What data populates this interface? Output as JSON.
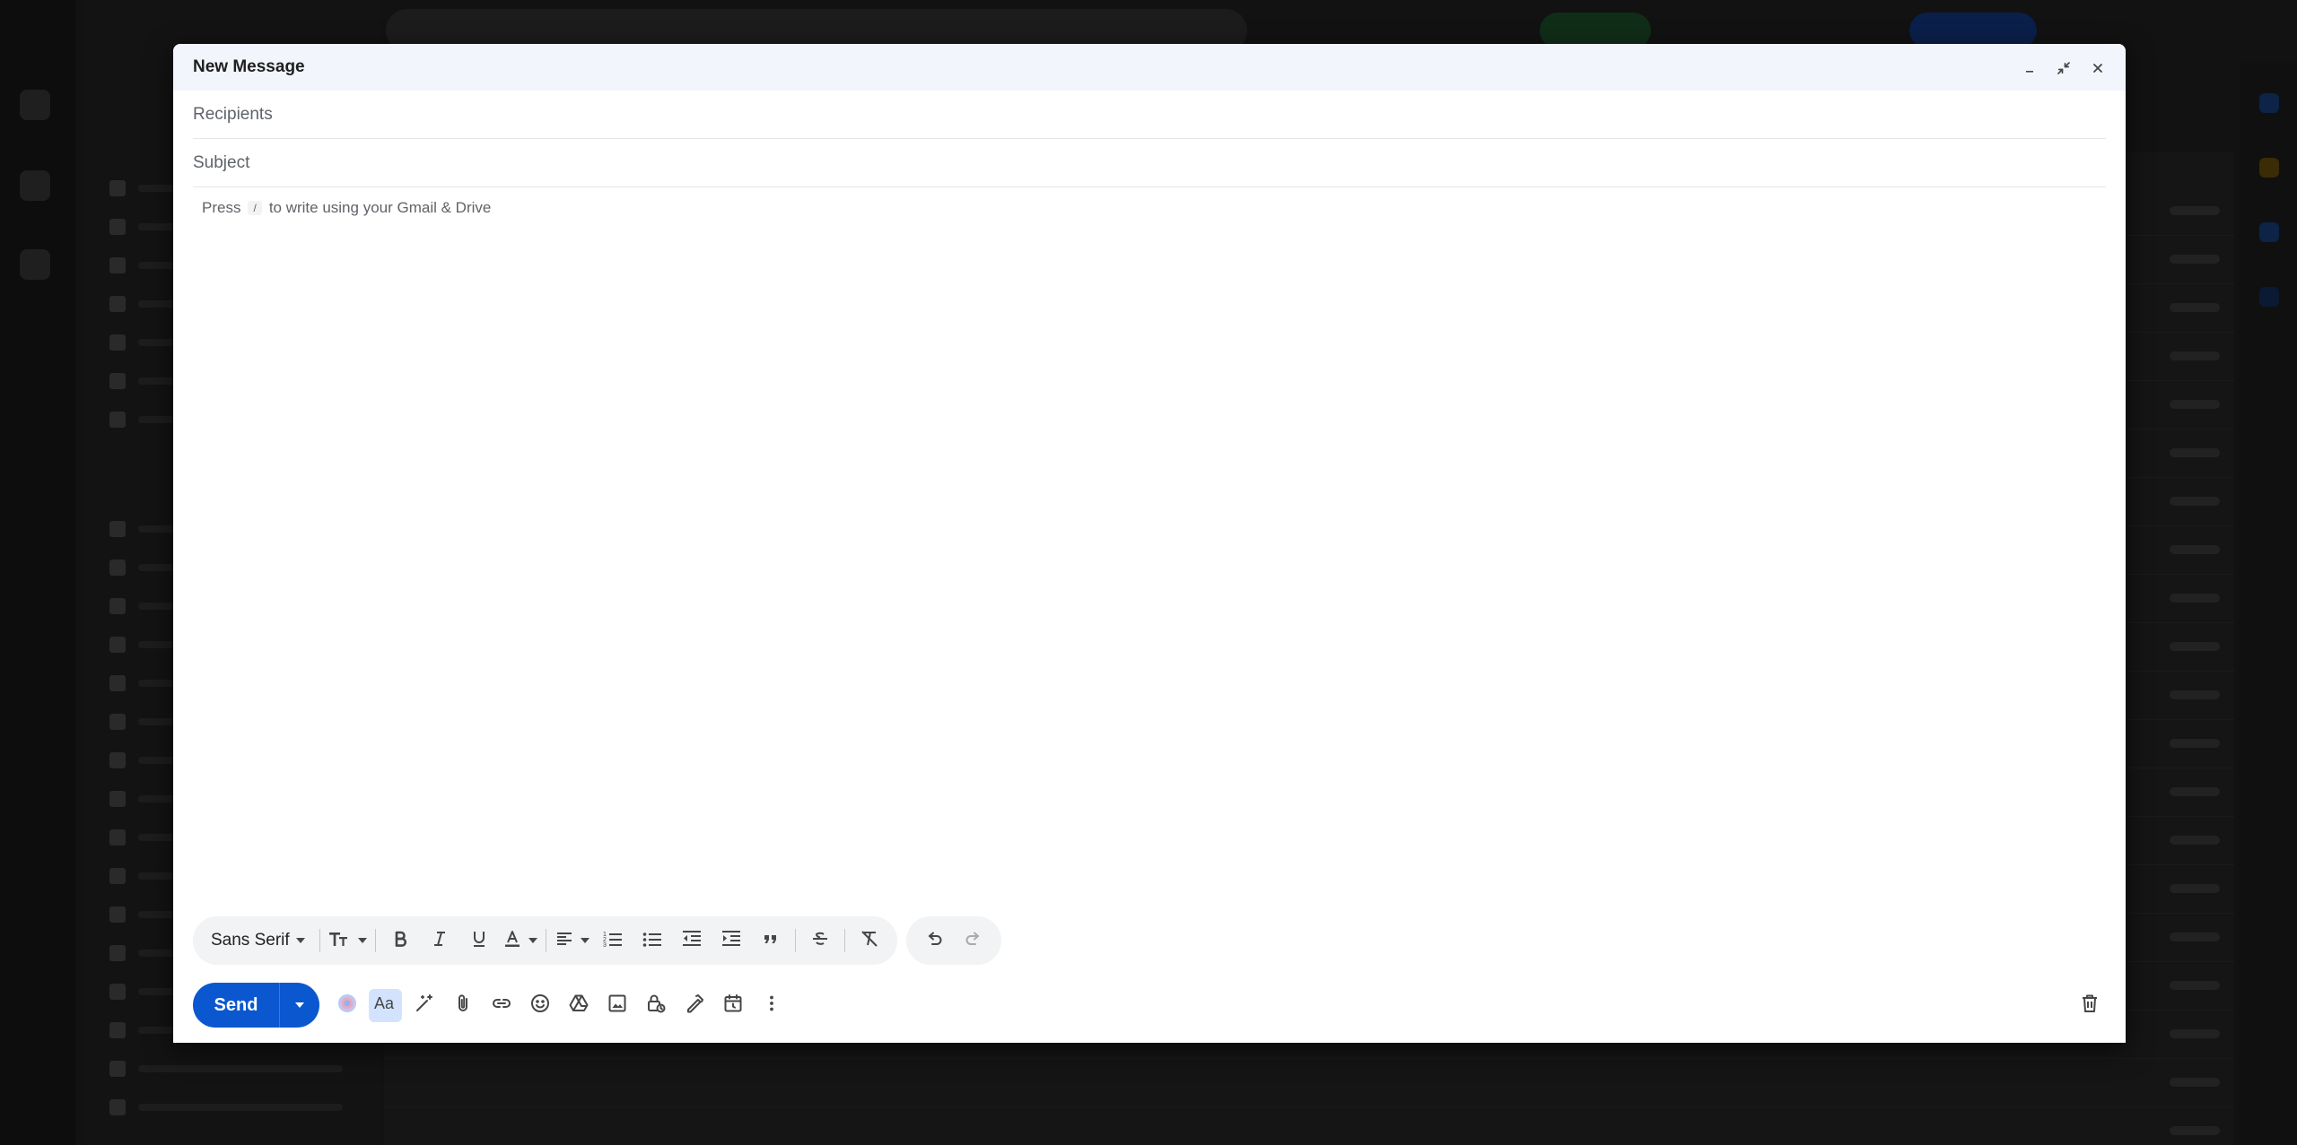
{
  "compose": {
    "title": "New Message",
    "recipients_placeholder": "Recipients",
    "subject_placeholder": "Subject",
    "body_hint_prefix": "Press",
    "body_hint_key": "/",
    "body_hint_suffix": "to write using your Gmail & Drive"
  },
  "toolbar": {
    "font_family": "Sans Serif"
  },
  "actions": {
    "send_label": "Send"
  },
  "colors": {
    "accent": "#0b57d0",
    "titlebar_bg": "#f2f6fc",
    "toolbar_bg": "#f1f3f4"
  },
  "icons": {
    "window": [
      "minimize-icon",
      "exit-fullscreen-icon",
      "close-icon"
    ],
    "formatting": [
      "text-size-icon",
      "bold-icon",
      "italic-icon",
      "underline-icon",
      "text-color-icon",
      "align-icon",
      "numbered-list-icon",
      "bulleted-list-icon",
      "indent-less-icon",
      "indent-more-icon",
      "quote-icon",
      "strikethrough-icon",
      "remove-formatting-icon",
      "undo-icon",
      "redo-icon"
    ],
    "actions": [
      "send-options-icon",
      "gemini-icon",
      "formatting-options-icon",
      "help-me-write-icon",
      "attach-icon",
      "link-icon",
      "emoji-icon",
      "drive-icon",
      "photo-icon",
      "confidential-icon",
      "signature-icon",
      "schedule-icon",
      "more-options-icon",
      "discard-icon"
    ]
  }
}
